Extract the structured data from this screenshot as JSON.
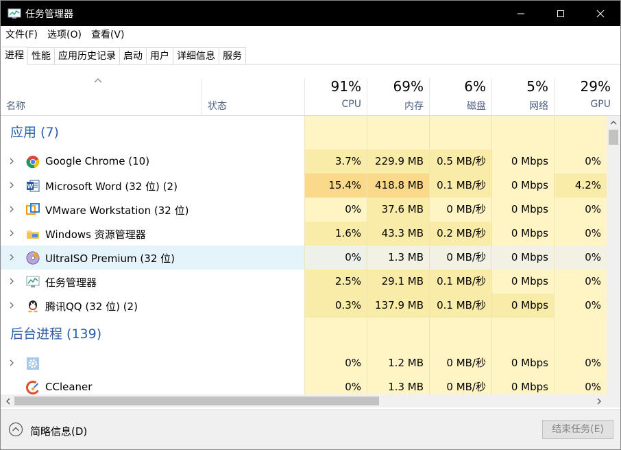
{
  "window": {
    "title": "任务管理器"
  },
  "menu": [
    "文件(F)",
    "选项(O)",
    "查看(V)"
  ],
  "tabs": [
    "进程",
    "性能",
    "应用历史记录",
    "启动",
    "用户",
    "详细信息",
    "服务"
  ],
  "active_tab": 0,
  "header": {
    "name_label": "名称",
    "status_label": "状态",
    "columns": [
      {
        "pct": "91%",
        "label": "CPU"
      },
      {
        "pct": "69%",
        "label": "内存"
      },
      {
        "pct": "6%",
        "label": "磁盘"
      },
      {
        "pct": "5%",
        "label": "网络"
      },
      {
        "pct": "29%",
        "label": "GPU"
      }
    ]
  },
  "rows": [
    {
      "type": "group",
      "label": "应用 (7)"
    },
    {
      "type": "proc",
      "icon": "chrome-icon",
      "name": "Google Chrome (10)",
      "cells": [
        "3.7%",
        "229.9 MB",
        "0.5 MB/秒",
        "0 Mbps",
        "0%"
      ],
      "heat": [
        "l",
        "l",
        "l",
        "p",
        "p"
      ]
    },
    {
      "type": "proc",
      "icon": "word-icon",
      "name": "Microsoft Word (32 位) (2)",
      "cells": [
        "15.4%",
        "418.8 MB",
        "0.1 MB/秒",
        "0 Mbps",
        "4.2%"
      ],
      "heat": [
        "m",
        "m",
        "l",
        "p",
        "l"
      ]
    },
    {
      "type": "proc",
      "icon": "vmware-icon",
      "name": "VMware Workstation (32 位)",
      "cells": [
        "0%",
        "37.6 MB",
        "0 MB/秒",
        "0 Mbps",
        "0%"
      ],
      "heat": [
        "p",
        "l",
        "p",
        "p",
        "p"
      ]
    },
    {
      "type": "proc",
      "icon": "folder-icon",
      "name": "Windows 资源管理器",
      "cells": [
        "1.6%",
        "43.3 MB",
        "0.2 MB/秒",
        "0 Mbps",
        "0%"
      ],
      "heat": [
        "l",
        "l",
        "l",
        "p",
        "p"
      ]
    },
    {
      "type": "proc",
      "icon": "disc-icon",
      "name": "UltraISO Premium (32 位)",
      "cells": [
        "0%",
        "1.3 MB",
        "0 MB/秒",
        "0 Mbps",
        "0%"
      ],
      "heat": [
        "p",
        "p",
        "p",
        "p",
        "p"
      ],
      "hover": true
    },
    {
      "type": "proc",
      "icon": "taskmgr-icon",
      "name": "任务管理器",
      "cells": [
        "2.5%",
        "29.1 MB",
        "0.1 MB/秒",
        "0 Mbps",
        "0%"
      ],
      "heat": [
        "l",
        "l",
        "l",
        "p",
        "p"
      ]
    },
    {
      "type": "proc",
      "icon": "qq-icon",
      "name": "腾讯QQ (32 位) (2)",
      "cells": [
        "0.3%",
        "137.9 MB",
        "0.1 MB/秒",
        "0 Mbps",
        "0%"
      ],
      "heat": [
        "l",
        "l",
        "l",
        "l",
        "p"
      ]
    },
    {
      "type": "group",
      "label": "后台进程 (139)"
    },
    {
      "type": "proc",
      "icon": "gear-icon",
      "name": "",
      "cells": [
        "0%",
        "1.2 MB",
        "0 MB/秒",
        "0 Mbps",
        "0%"
      ],
      "heat": [
        "p",
        "p",
        "p",
        "p",
        "p"
      ]
    },
    {
      "type": "proc",
      "icon": "ccleaner-icon",
      "name": "CCleaner",
      "cells": [
        "0%",
        "1.3 MB",
        "0 MB/秒",
        "0 Mbps",
        "0%"
      ],
      "heat": [
        "p",
        "p",
        "p",
        "p",
        "p"
      ],
      "noexpander": true
    }
  ],
  "footer": {
    "fewer_details": "简略信息(D)",
    "end_task": "结束任务(E)"
  },
  "colors": {
    "heat_p": "#fff4c4",
    "heat_l": "#f9eca8",
    "heat_m": "#fad98a",
    "group": "#2a5caa",
    "hover": "#e5f3fb"
  }
}
